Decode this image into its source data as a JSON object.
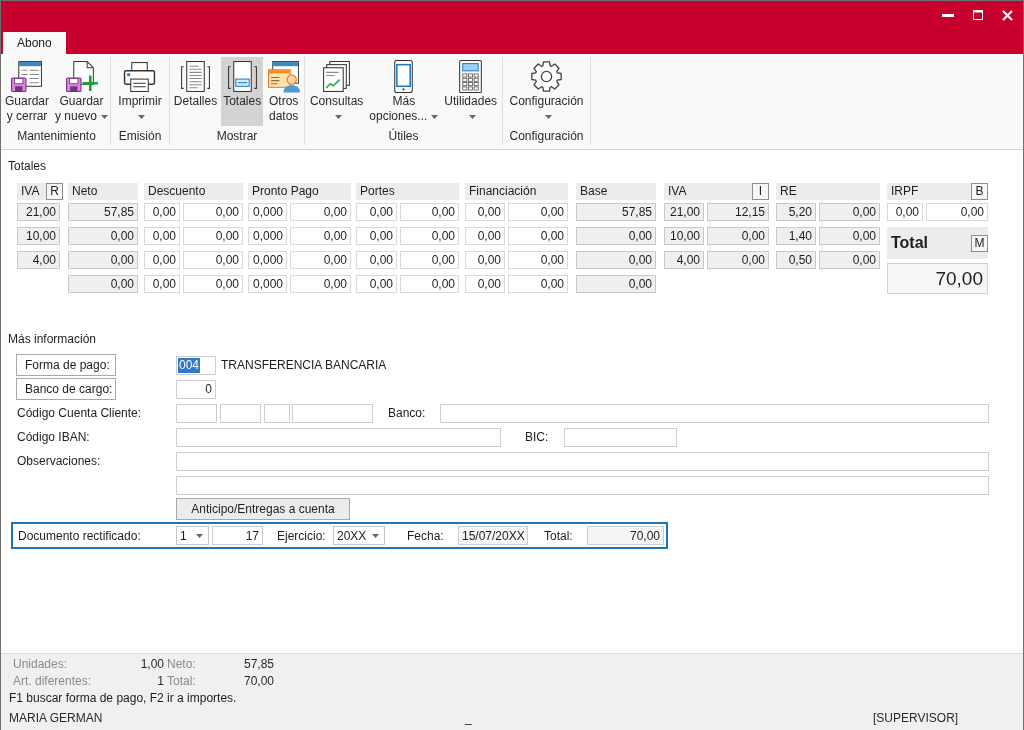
{
  "tabs": [
    {
      "label": "Abono",
      "selected": true
    }
  ],
  "ribbon": {
    "groups": [
      {
        "label": "Mantenimiento",
        "buttons": [
          {
            "lines": [
              "Guardar",
              "y cerrar"
            ],
            "dropdown": false,
            "selected": false
          },
          {
            "lines": [
              "Guardar",
              "y nuevo"
            ],
            "dropdown": true,
            "selected": false
          }
        ]
      },
      {
        "label": "Emisión",
        "buttons": [
          {
            "lines": [
              "Imprimir"
            ],
            "dropdown": true,
            "selected": false
          }
        ]
      },
      {
        "label": "Mostrar",
        "buttons": [
          {
            "lines": [
              "Detalles"
            ],
            "dropdown": false,
            "selected": false
          },
          {
            "lines": [
              "Totales"
            ],
            "dropdown": false,
            "selected": true
          },
          {
            "lines": [
              "Otros",
              "datos"
            ],
            "dropdown": false,
            "selected": false
          }
        ]
      },
      {
        "label": "Útiles",
        "buttons": [
          {
            "lines": [
              "Consultas"
            ],
            "dropdown": true,
            "selected": false
          },
          {
            "lines": [
              "Más",
              "opciones..."
            ],
            "dropdown": true,
            "selected": false
          },
          {
            "lines": [
              "Utilidades"
            ],
            "dropdown": true,
            "selected": false
          }
        ]
      },
      {
        "label": "Configuración",
        "buttons": [
          {
            "lines": [
              "Configuración"
            ],
            "dropdown": true,
            "selected": false
          }
        ]
      }
    ]
  },
  "totales": {
    "title": "Totales",
    "columns": [
      {
        "label": "IVA",
        "key": "R",
        "editable": false,
        "rows": [
          [
            "21,00"
          ],
          [
            "10,00"
          ],
          [
            "4,00"
          ]
        ]
      },
      {
        "label": "Neto",
        "editable": false,
        "rows": [
          [
            "57,85"
          ],
          [
            "0,00"
          ],
          [
            "0,00"
          ],
          [
            "0,00"
          ]
        ]
      },
      {
        "label": "Descuento",
        "editable": true,
        "rows": [
          [
            "0,00",
            "0,00"
          ],
          [
            "0,00",
            "0,00"
          ],
          [
            "0,00",
            "0,00"
          ],
          [
            "0,00",
            "0,00"
          ]
        ]
      },
      {
        "label": "Pronto Pago",
        "editable": true,
        "rows": [
          [
            "0,000",
            "0,00"
          ],
          [
            "0,000",
            "0,00"
          ],
          [
            "0,000",
            "0,00"
          ],
          [
            "0,000",
            "0,00"
          ]
        ]
      },
      {
        "label": "Portes",
        "editable": true,
        "rows": [
          [
            "0,00",
            "0,00"
          ],
          [
            "0,00",
            "0,00"
          ],
          [
            "0,00",
            "0,00"
          ],
          [
            "0,00",
            "0,00"
          ]
        ]
      },
      {
        "label": "Financiación",
        "editable": true,
        "rows": [
          [
            "0,00",
            "0,00"
          ],
          [
            "0,00",
            "0,00"
          ],
          [
            "0,00",
            "0,00"
          ],
          [
            "0,00",
            "0,00"
          ]
        ]
      },
      {
        "label": "Base",
        "editable": false,
        "rows": [
          [
            "57,85"
          ],
          [
            "0,00"
          ],
          [
            "0,00"
          ],
          [
            "0,00"
          ]
        ]
      },
      {
        "label": "IVA",
        "key": "I",
        "editable": false,
        "rows": [
          [
            "21,00",
            "12,15"
          ],
          [
            "10,00",
            "0,00"
          ],
          [
            "4,00",
            "0,00"
          ]
        ]
      },
      {
        "label": "RE",
        "editable": false,
        "rows": [
          [
            "5,20",
            "0,00"
          ],
          [
            "1,40",
            "0,00"
          ],
          [
            "0,50",
            "0,00"
          ]
        ]
      },
      {
        "label": "IRPF",
        "key": "B",
        "editable": true,
        "rows": [
          [
            "0,00",
            "0,00"
          ]
        ]
      }
    ],
    "total": {
      "label": "Total",
      "key": "M",
      "value": "70,00"
    }
  },
  "mas_informacion": {
    "title": "Más información",
    "forma_pago": {
      "button": "Forma de pago:",
      "code": "004",
      "code_selected": true,
      "name": "TRANSFERENCIA BANCARIA"
    },
    "banco_cargo": {
      "button": "Banco de cargo:",
      "value": "0"
    },
    "ccc": {
      "label": "Código Cuenta Cliente:",
      "banco_label": "Banco:"
    },
    "iban": {
      "label": "Código IBAN:",
      "bic_label": "BIC:"
    },
    "observaciones": {
      "label": "Observaciones:"
    },
    "anticipo_button": "Anticipo/Entregas a cuenta",
    "documento_rectificado": {
      "label": "Documento rectificado:",
      "serie": "1",
      "numero": "17",
      "ejercicio_label": "Ejercicio:",
      "ejercicio": "20XX",
      "fecha_label": "Fecha:",
      "fecha": "15/07/20XX",
      "total_label": "Total:",
      "total": "70,00",
      "focused": true
    }
  },
  "summary": {
    "rows": [
      {
        "items": [
          {
            "label": "Unidades:",
            "value": "1,00"
          },
          {
            "label": "Neto:",
            "value": "57,85"
          }
        ]
      },
      {
        "items": [
          {
            "label": "Art. diferentes:",
            "value": "1"
          },
          {
            "label": "Total:",
            "value": "70,00"
          }
        ]
      }
    ]
  },
  "hint": "F1 buscar forma de pago, F2 ir a importes.",
  "status_bar": {
    "user": "MARIA GERMAN",
    "indicator": "_",
    "role": "[SUPERVISOR]"
  }
}
